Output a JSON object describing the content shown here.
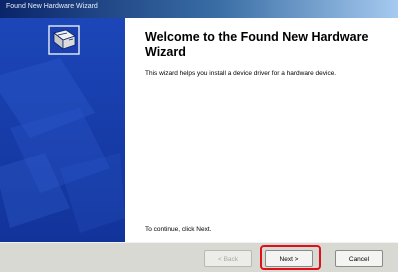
{
  "window": {
    "title": "Found New Hardware Wizard"
  },
  "wizard": {
    "heading": "Welcome to the Found New Hardware Wizard",
    "description": "This wizard helps you install a device driver for a hardware device.",
    "continue_hint": "To continue, click Next."
  },
  "buttons": {
    "back_label": "< Back",
    "next_label": "Next >",
    "cancel_label": "Cancel"
  },
  "annotation": {
    "highlight_color": "#e0101a",
    "highlighted": "next-button"
  },
  "colors": {
    "side_panel": "#1a3fae",
    "title_bar": "#0a246a"
  }
}
